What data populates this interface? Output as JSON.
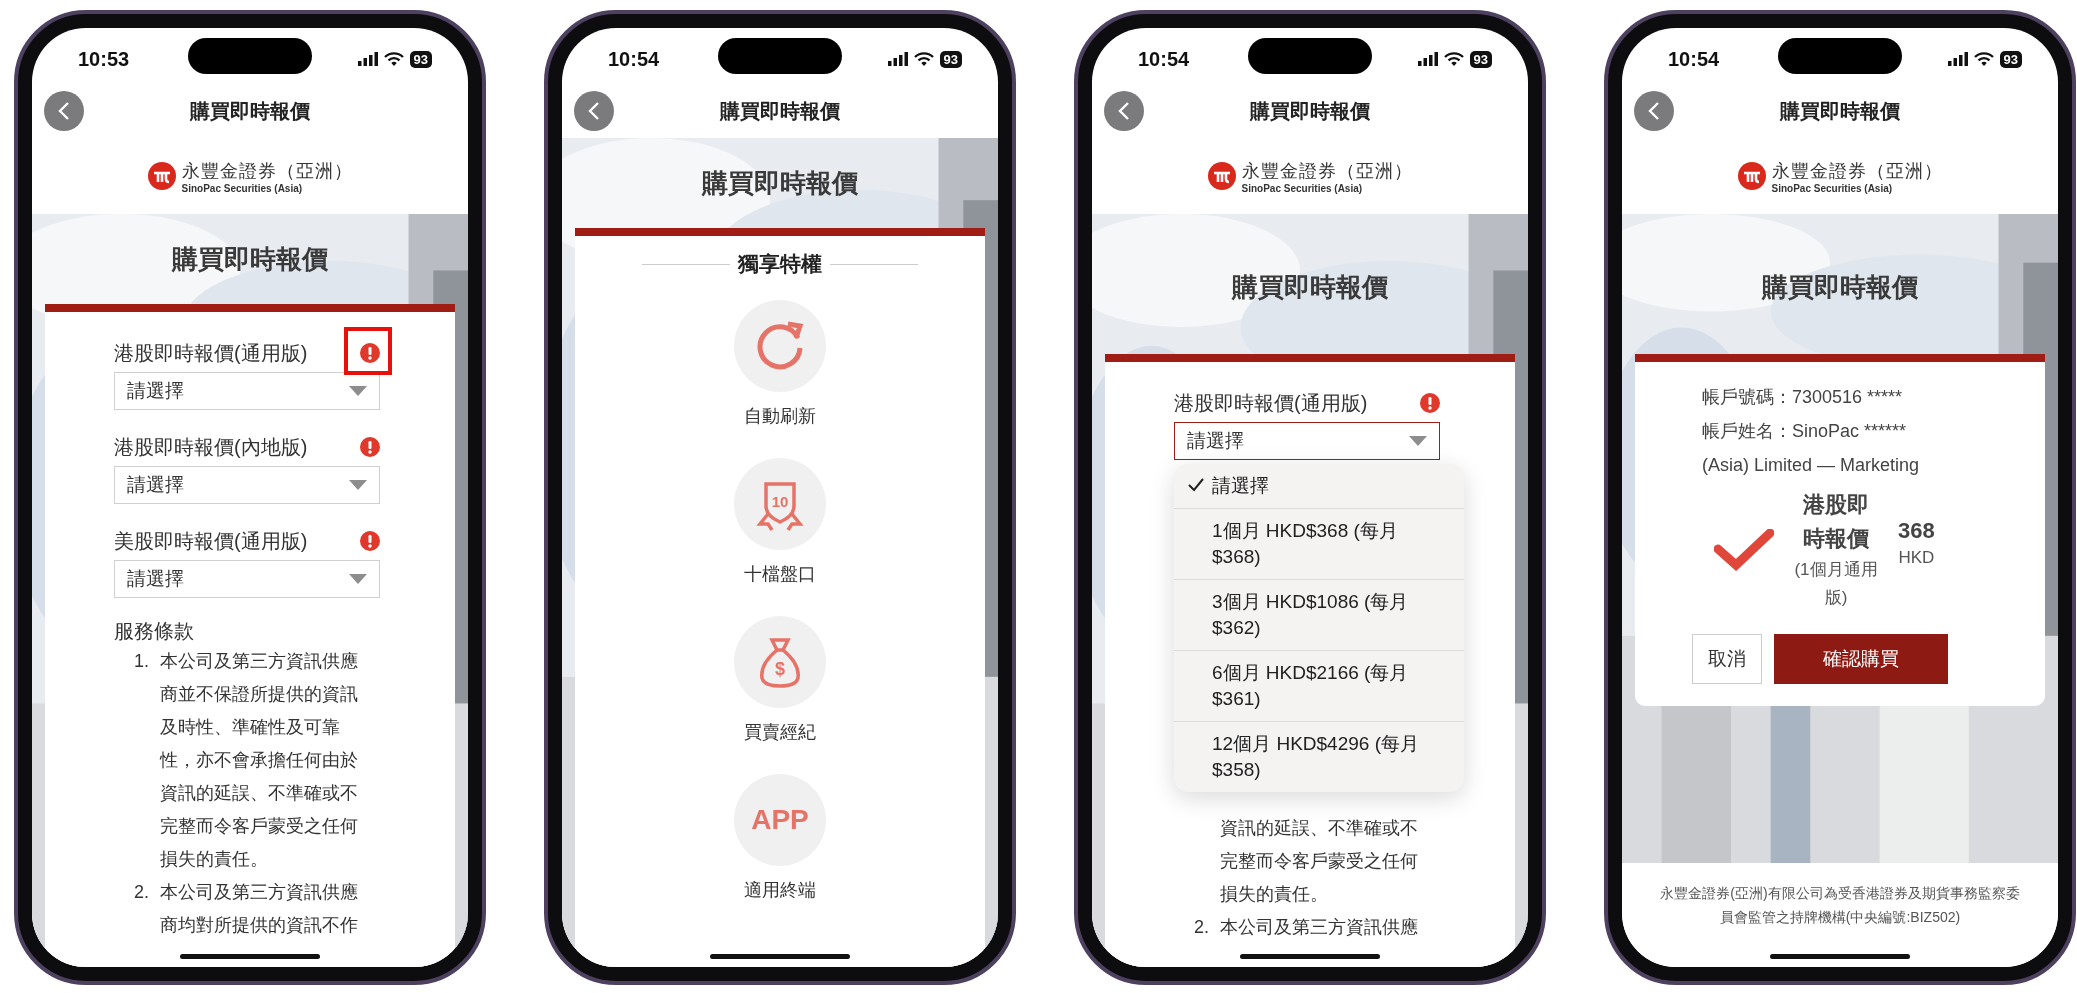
{
  "phones": [
    {
      "kind": "form",
      "time": "10:53",
      "battery": "93",
      "title": "購買即時報價",
      "brand": {
        "name": "永豐金證券（亞洲）",
        "tagline": "SinoPac Securities (Asia)"
      },
      "banner_title": "購買即時報價",
      "fields": [
        {
          "label": "港股即時報價(通用版)",
          "value": "請選擇",
          "highlighted": false,
          "callout": true
        },
        {
          "label": "港股即時報價(內地版)",
          "value": "請選擇",
          "highlighted": false,
          "callout": false
        },
        {
          "label": "美股即時報價(通用版)",
          "value": "請選擇",
          "highlighted": false,
          "callout": false
        }
      ],
      "terms": {
        "heading": "服務條款",
        "items": [
          {
            "number": "1.",
            "text": "本公司及第三方資訊供應商並不保證所提供的資訊及時性、準確性及可靠性，亦不會承擔任何由於資訊的延誤、不準確或不完整而令客戶蒙受之任何損失的責任。"
          },
          {
            "number": "2.",
            "text": "本公司及第三方資訊供應商均對所提供的資訊不作"
          }
        ]
      }
    },
    {
      "kind": "features",
      "time": "10:54",
      "battery": "93",
      "title": "購買即時報價",
      "banner_title": "購買即時報價",
      "section_title": "獨享特權",
      "features": [
        {
          "kind": "refresh",
          "label": "自動刷新"
        },
        {
          "kind": "badge",
          "icon_text": "10",
          "label": "十檔盤口"
        },
        {
          "kind": "moneybag",
          "icon_text": "$",
          "label": "買賣經紀"
        },
        {
          "kind": "text",
          "icon_text": "APP",
          "label": "適用終端"
        }
      ]
    },
    {
      "kind": "form",
      "time": "10:54",
      "battery": "93",
      "title": "購買即時報價",
      "brand": {
        "name": "永豐金證券（亞洲）",
        "tagline": "SinoPac Securities (Asia)"
      },
      "banner_title": "購買即時報價",
      "fields": [
        {
          "label": "港股即時報價(通用版)",
          "value": "請選擇",
          "highlighted": true,
          "callout": false,
          "options": [
            {
              "label": "請選擇",
              "selected": true
            },
            {
              "label": "1個月 HKD$368 (每月$368)",
              "selected": false
            },
            {
              "label": "3個月 HKD$1086 (每月$362)",
              "selected": false
            },
            {
              "label": "6個月 HKD$2166 (每月$361)",
              "selected": false
            },
            {
              "label": "12個月 HKD$4296 (每月$358)",
              "selected": false
            }
          ]
        }
      ],
      "terms": {
        "items": [
          {
            "text": "資訊的延誤、不準確或不完整而令客戶蒙受之任何損失的責任。"
          },
          {
            "number": "2.",
            "text": "本公司及第三方資訊供應"
          }
        ]
      }
    },
    {
      "kind": "confirm",
      "time": "10:54",
      "battery": "93",
      "title": "購買即時報價",
      "brand": {
        "name": "永豐金證券（亞洲）",
        "tagline": "SinoPac Securities (Asia)"
      },
      "banner_title": "購買即時報價",
      "account_lines": [
        "帳戶號碼：7300516 *****",
        "帳戶姓名：SinoPac ****** (Asia) Limited — Marketing"
      ],
      "product": {
        "name": "港股即時報價",
        "plan": "(1個月通用版)",
        "price": "368",
        "currency": "HKD"
      },
      "buttons": [
        {
          "label": "取消",
          "kind": "secondary"
        },
        {
          "label": "確認購買",
          "kind": "primary"
        }
      ],
      "footer": "永豐金證券(亞洲)有限公司為受香港證券及期貨事務監察委員會監管之持牌機構(中央編號:BIZ502)"
    }
  ]
}
